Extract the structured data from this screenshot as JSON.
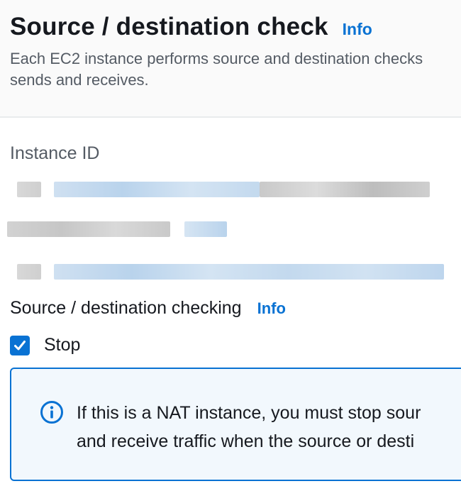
{
  "modal": {
    "title": "Source / destination check",
    "title_info": "Info",
    "description_line1": "Each EC2 instance performs source and destination checks",
    "description_line2": "sends and receives."
  },
  "instance": {
    "label": "Instance ID"
  },
  "source_dest": {
    "label": "Source / destination checking",
    "info": "Info",
    "checkbox_label": "Stop",
    "checked": true
  },
  "alert": {
    "icon": "info-circle-icon",
    "line1": "If this is a NAT instance, you must stop sour",
    "line2": "and receive traffic when the source or desti"
  },
  "colors": {
    "accent": "#0972d3",
    "text": "#16191f",
    "secondary_text": "#545b64",
    "alert_bg": "#f2f8fd"
  }
}
